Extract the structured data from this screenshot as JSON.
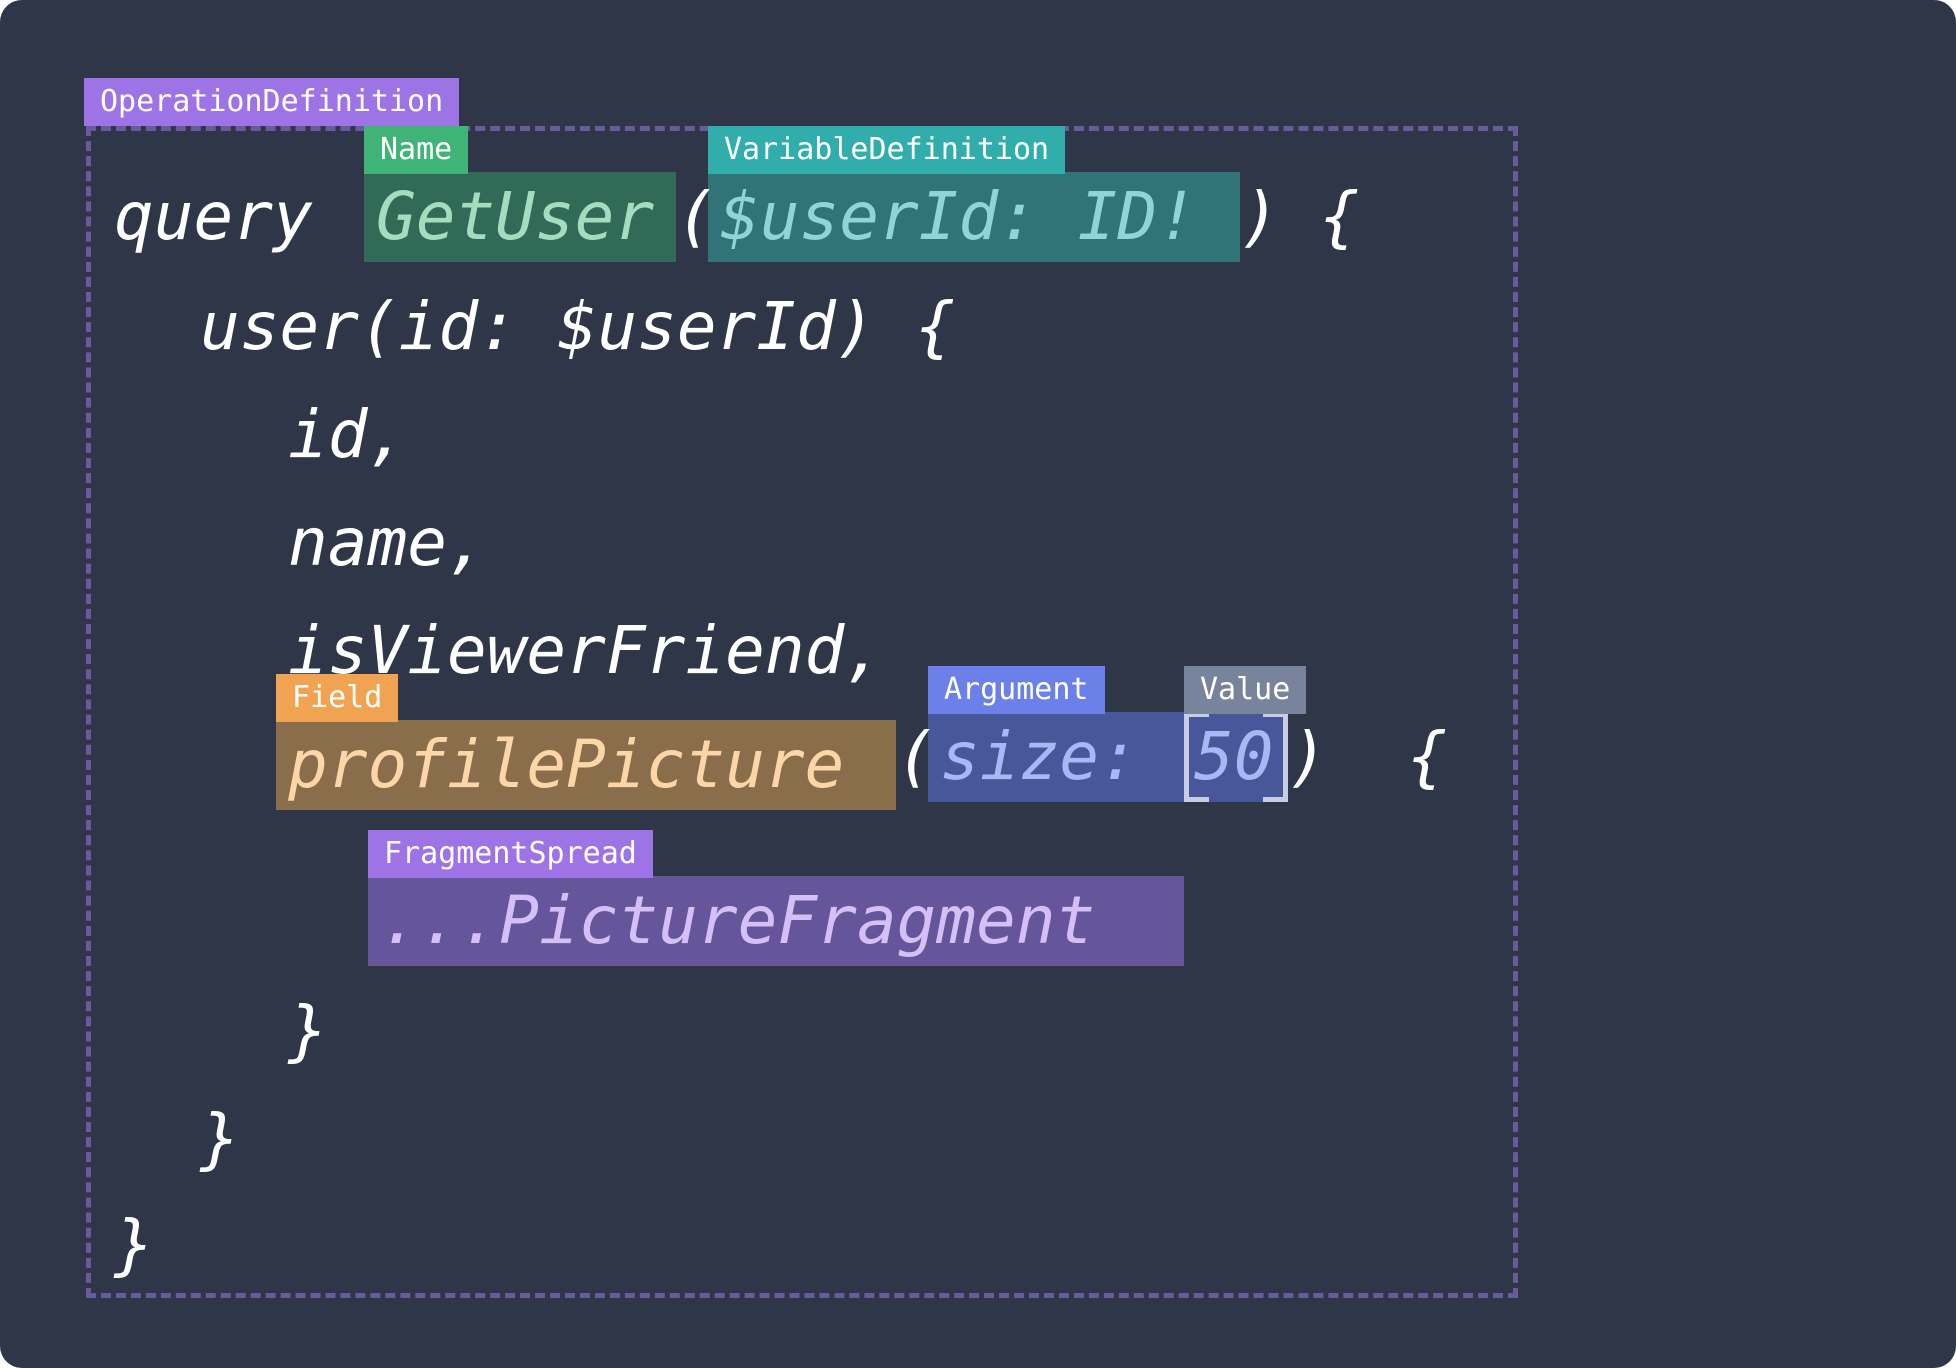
{
  "labels": {
    "operation_definition": "OperationDefinition",
    "name": "Name",
    "variable_definition": "VariableDefinition",
    "field": "Field",
    "argument": "Argument",
    "value": "Value",
    "fragment_spread": "FragmentSpread"
  },
  "code": {
    "query_keyword": "query ",
    "operation_name": "GetUser",
    "open_paren": "(",
    "variable_definition": "$userId: ID!",
    "close_paren_brace": ") {",
    "line2": "user(id: $userId) {",
    "line3": "id,",
    "line4": "name,",
    "line5": "isViewerFriend,",
    "field_name": "profilePicture",
    "open_paren_2": "(",
    "argument": "size: ",
    "value": "50",
    "close_paren_brace_2": ")  {",
    "fragment_spread": "...PictureFragment",
    "close_brace_inner": "}",
    "close_brace_user": "}",
    "close_brace_query": "}"
  },
  "colors": {
    "background": "#2e3648",
    "operation_border": "#6a5a9c",
    "operation_tag": "#9d73e6",
    "name_tag": "#3fb476",
    "name_highlight": "#316b58",
    "variable_tag": "#31aeab",
    "variable_highlight": "#307478",
    "field_tag": "#f0a452",
    "field_highlight": "#8a6e4b",
    "argument_tag": "#6b80e8",
    "argument_highlight": "#48569a",
    "value_tag": "#78839c",
    "fragment_tag": "#9d73e6",
    "fragment_highlight": "#65559a"
  }
}
